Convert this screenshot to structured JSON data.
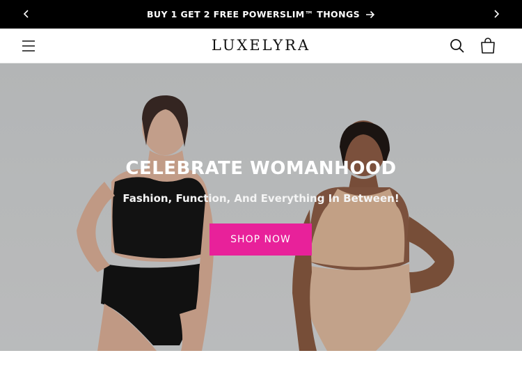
{
  "announcement": {
    "text": "BUY 1 GET 2 FREE POWERSLIM™ THONGS",
    "prev_icon": "chevron-left-icon",
    "next_icon": "chevron-right-icon",
    "link_icon": "arrow-right-icon"
  },
  "header": {
    "logo": "LUXELYRA",
    "menu_icon": "hamburger-menu-icon",
    "search_icon": "search-icon",
    "cart_icon": "shopping-bag-icon"
  },
  "hero": {
    "title": "CELEBRATE WOMANHOOD",
    "subtitle": "Fashion, Function, And Everything In Between!",
    "cta_label": "SHOP NOW"
  },
  "colors": {
    "announcement_bg": "#000000",
    "cta_bg": "#e8219a",
    "hero_bg": "#c9cbcc"
  }
}
